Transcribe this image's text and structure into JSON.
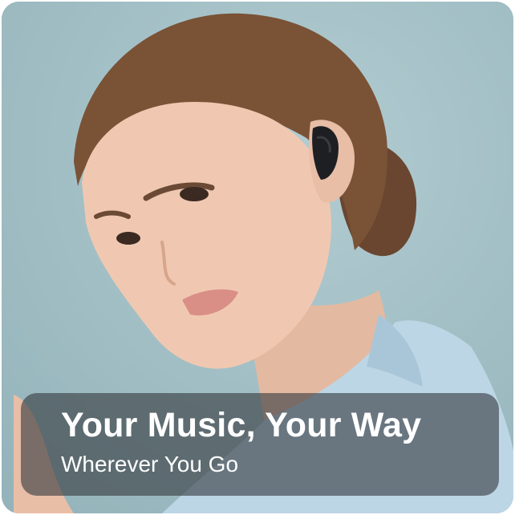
{
  "banner": {
    "headline": "Your Music, Your Way",
    "subline": "Wherever You Go"
  },
  "colors": {
    "background": "#a3c0c6",
    "banner": "#373c40",
    "text": "#ffffff",
    "earbud": "#1e1f22",
    "shirt": "#bcd6e6"
  }
}
